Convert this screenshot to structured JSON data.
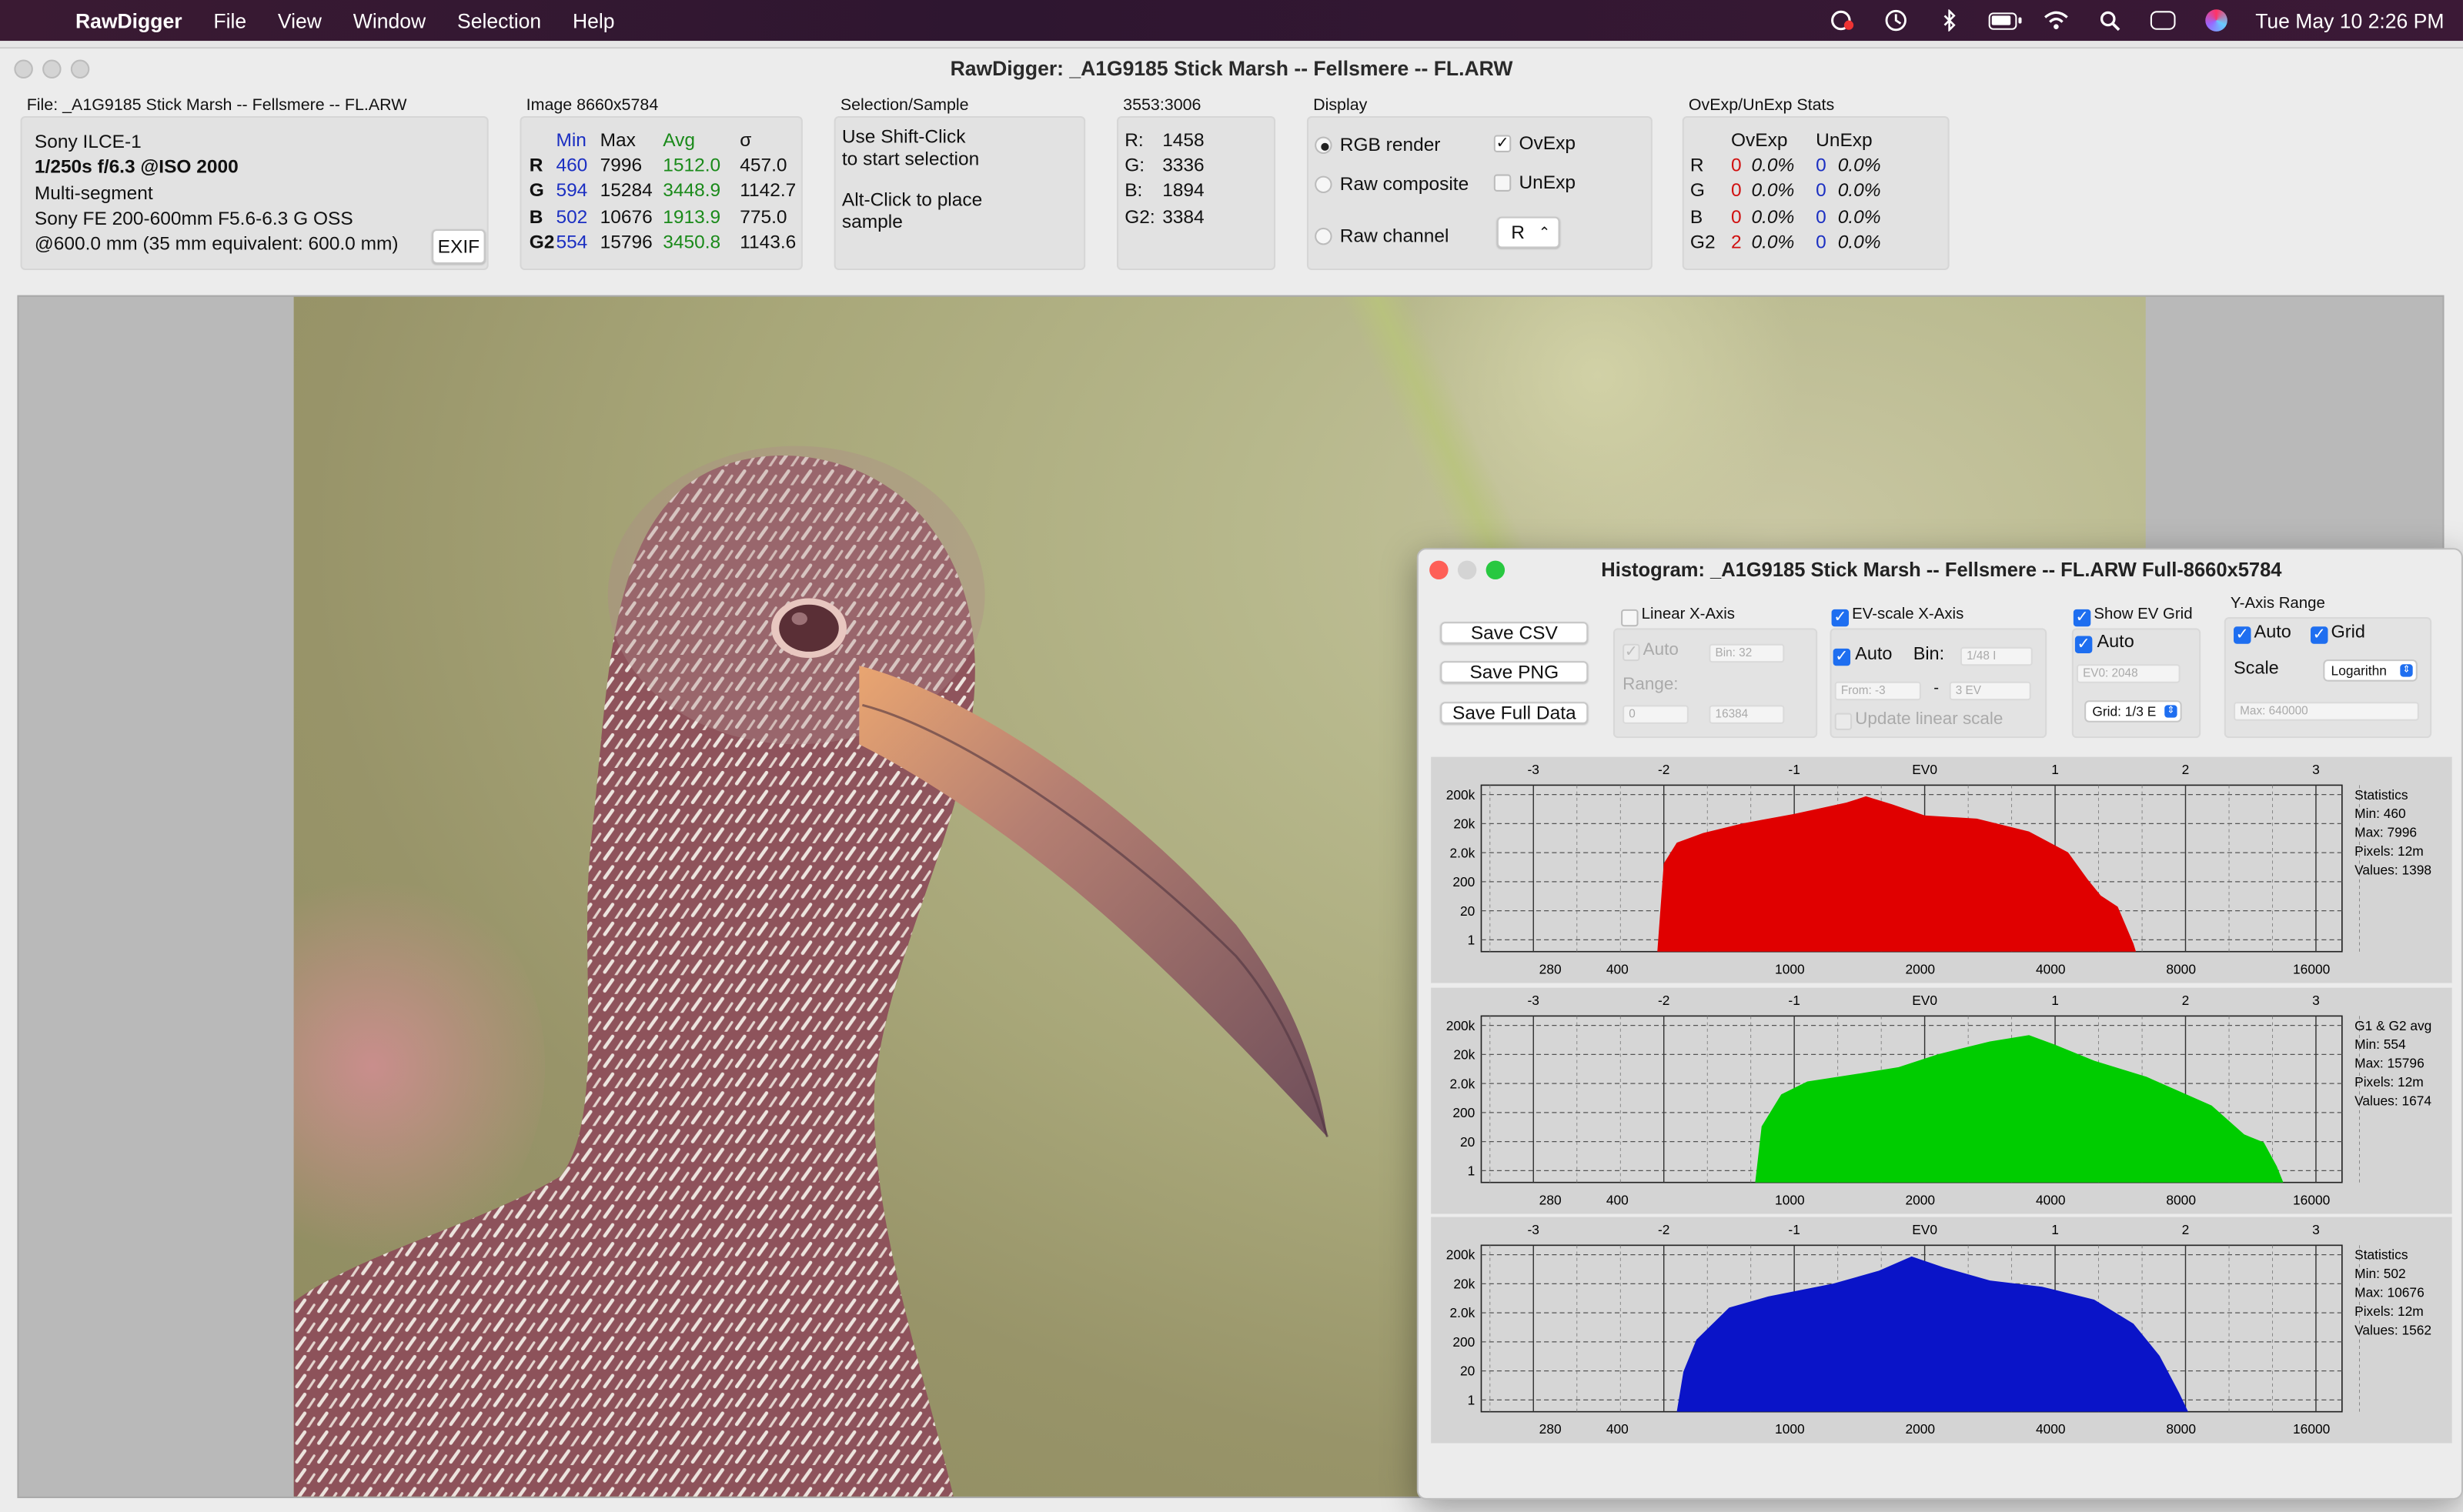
{
  "menubar": {
    "app": "RawDigger",
    "items": [
      "File",
      "View",
      "Window",
      "Selection",
      "Help"
    ],
    "clock": "Tue May 10  2:26 PM"
  },
  "window": {
    "title": "RawDigger: _A1G9185 Stick Marsh -- Fellsmere --  FL.ARW"
  },
  "file_info": {
    "label": "File: _A1G9185 Stick Marsh -- Fellsmere --  FL.ARW",
    "camera": "Sony ILCE-1",
    "exposure": "1/250s f/6.3 @ISO 2000",
    "metering": "Multi-segment",
    "lens": "Sony FE 200-600mm F5.6-6.3 G OSS",
    "focal": "@600.0 mm (35 mm equivalent: 600.0 mm)",
    "exif_button": "EXIF"
  },
  "image_stats": {
    "label": "Image 8660x5784",
    "headers": [
      "Min",
      "Max",
      "Avg",
      "σ"
    ],
    "rows": [
      {
        "ch": "R",
        "min": "460",
        "max": "7996",
        "avg": "1512.0",
        "sd": "457.0"
      },
      {
        "ch": "G",
        "min": "594",
        "max": "15284",
        "avg": "3448.9",
        "sd": "1142.7"
      },
      {
        "ch": "B",
        "min": "502",
        "max": "10676",
        "avg": "1913.9",
        "sd": "775.0"
      },
      {
        "ch": "G2",
        "min": "554",
        "max": "15796",
        "avg": "3450.8",
        "sd": "1143.6"
      }
    ]
  },
  "selection": {
    "label": "Selection/Sample",
    "line1": "Use Shift-Click",
    "line2": "to start selection",
    "line3": "Alt-Click to place",
    "line4": "sample"
  },
  "sample": {
    "label": "3553:3006",
    "rows": [
      {
        "ch": "R:",
        "v": "1458"
      },
      {
        "ch": "G:",
        "v": "3336"
      },
      {
        "ch": "B:",
        "v": "1894"
      },
      {
        "ch": "G2:",
        "v": "3384"
      }
    ]
  },
  "display": {
    "label": "Display",
    "rgb": "RGB render",
    "raw_comp": "Raw composite",
    "raw_ch": "Raw channel",
    "ovexp": "OvExp",
    "unexp": "UnExp",
    "channel": "R",
    "checkmark": "✓"
  },
  "ovexp_stats": {
    "label": "OvExp/UnExp Stats",
    "h1": "OvExp",
    "h2": "UnExp",
    "rows": [
      {
        "ch": "R",
        "on": "0",
        "op": "0.0%",
        "un": "0",
        "up": "0.0%"
      },
      {
        "ch": "G",
        "on": "0",
        "op": "0.0%",
        "un": "0",
        "up": "0.0%"
      },
      {
        "ch": "B",
        "on": "0",
        "op": "0.0%",
        "un": "0",
        "up": "0.0%"
      },
      {
        "ch": "G2",
        "on": "2",
        "op": "0.0%",
        "un": "0",
        "up": "0.0%"
      }
    ]
  },
  "histogram": {
    "title": "Histogram: _A1G9185 Stick Marsh -- Fellsmere --  FL.ARW Full-8660x5784",
    "save_csv": "Save CSV",
    "save_png": "Save PNG",
    "save_full": "Save Full Data",
    "linear_x": "Linear X-Axis",
    "auto": "Auto",
    "bin_ph": "Bin: 32",
    "range": "Range:",
    "range_from": "0",
    "range_to": "16384",
    "ev_x": "EV-scale X-Axis",
    "bin": "Bin:",
    "bin_val": "1/48 I",
    "from_ev": "From: -3",
    "to_ev": "3 EV",
    "update_linear": "Update linear scale",
    "show_grid": "Show EV Grid",
    "ev0": "EV0: 2048",
    "grid_sel": "Grid: 1/3 E",
    "y_range": "Y-Axis Range",
    "grid": "Grid",
    "scale": "Scale",
    "scale_sel": "Logarithn",
    "max_ph": "Max: 640000",
    "ev_ticks": [
      "-3",
      "-2",
      "-1",
      "EV0",
      "1",
      "2",
      "3"
    ],
    "y_ticks": [
      "200k",
      "20k",
      "2.0k",
      "200",
      "20",
      "1"
    ],
    "x_ticks": [
      "280",
      "400",
      "1000",
      "2000",
      "4000",
      "8000",
      "16000"
    ],
    "panels": [
      {
        "color": "#e00000",
        "stats": [
          "Statistics",
          "Min: 460",
          "Max: 7996",
          "Pixels: 12m",
          "Values: 1398"
        ]
      },
      {
        "color": "#00cc00",
        "stats": [
          "G1 & G2 avg",
          "Min: 554",
          "Max: 15796",
          "Pixels: 12m",
          "Values: 1674"
        ]
      },
      {
        "color": "#0a14c8",
        "stats": [
          "Statistics",
          "Min: 502",
          "Max: 10676",
          "Pixels: 12m",
          "Values: 1562"
        ]
      }
    ]
  },
  "icons": {
    "apple": "",
    "menu_icons": [
      "creative-cloud-icon",
      "time-machine-icon",
      "bluetooth-icon",
      "battery-icon",
      "wifi-icon",
      "search-icon",
      "control-center-icon",
      "siri-icon"
    ]
  }
}
